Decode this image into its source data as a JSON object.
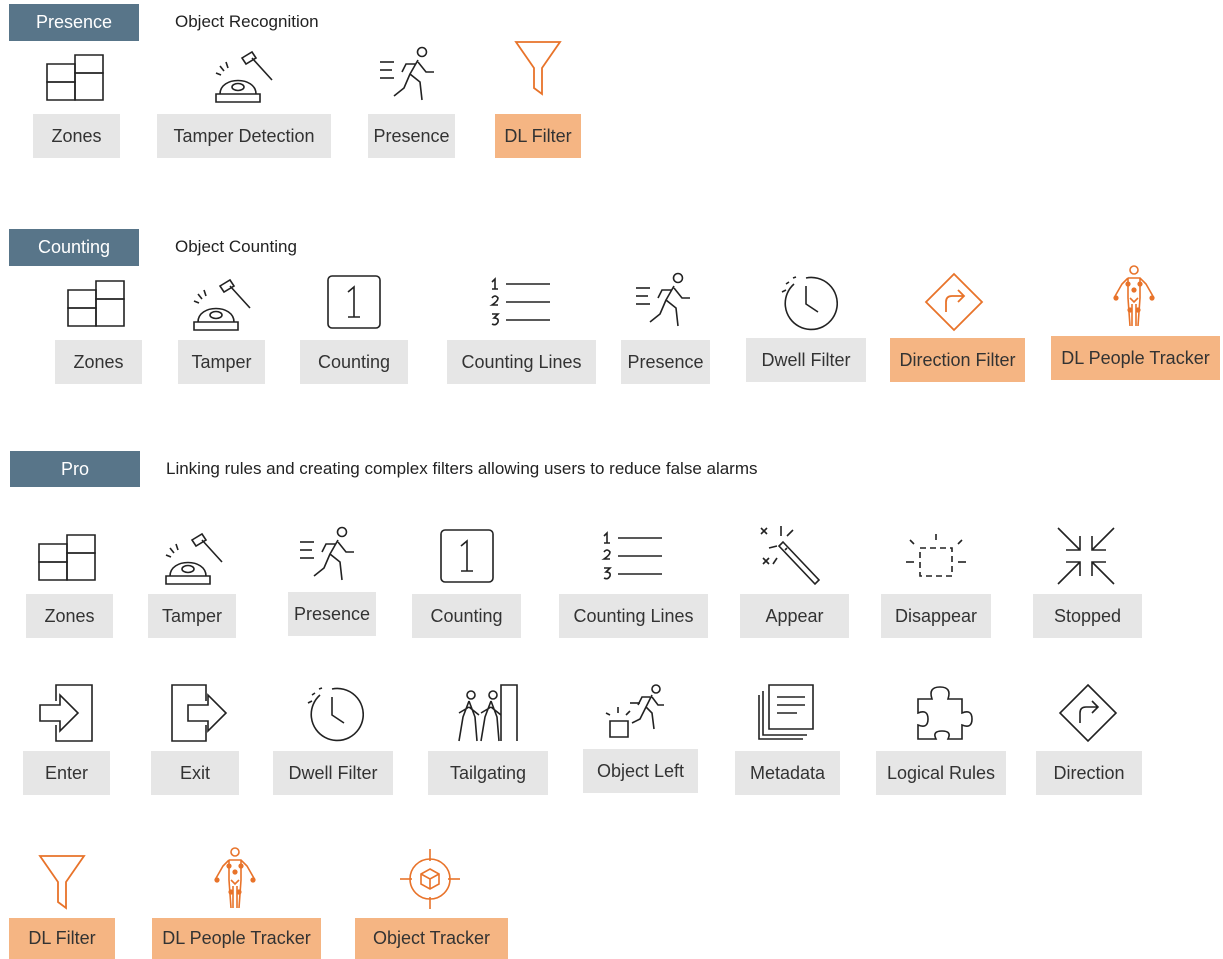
{
  "colors": {
    "tag_bg": "#587589",
    "tag_text": "#ffffff",
    "tile_bg": "#e6e6e6",
    "dl_bg": "#f5b583",
    "dl_icon": "#e8732a",
    "icon_stroke": "#222222"
  },
  "sections": [
    {
      "tag": "Presence",
      "description": "Object Recognition",
      "items": [
        {
          "icon": "zones-icon",
          "label": "Zones"
        },
        {
          "icon": "tamper-icon",
          "label": "Tamper Detection"
        },
        {
          "icon": "presence-icon",
          "label": "Presence"
        },
        {
          "icon": "filter-icon",
          "label": "DL Filter",
          "dl": true
        }
      ]
    },
    {
      "tag": "Counting",
      "description": "Object Counting",
      "items": [
        {
          "icon": "zones-icon",
          "label": "Zones"
        },
        {
          "icon": "tamper-icon",
          "label": "Tamper"
        },
        {
          "icon": "counting-icon",
          "label": "Counting"
        },
        {
          "icon": "counting-lines-icon",
          "label": "Counting Lines"
        },
        {
          "icon": "presence-icon",
          "label": "Presence"
        },
        {
          "icon": "dwell-icon",
          "label": "Dwell Filter"
        },
        {
          "icon": "direction-icon",
          "label": "Direction Filter",
          "dl": true
        },
        {
          "icon": "people-tracker-icon",
          "label": "DL People Tracker",
          "dl": true
        }
      ]
    },
    {
      "tag": "Pro",
      "description": "Linking rules and creating complex filters allowing users to reduce false alarms",
      "items": [
        {
          "icon": "zones-icon",
          "label": "Zones"
        },
        {
          "icon": "tamper-icon",
          "label": "Tamper"
        },
        {
          "icon": "presence-icon",
          "label": "Presence"
        },
        {
          "icon": "counting-icon",
          "label": "Counting"
        },
        {
          "icon": "counting-lines-icon",
          "label": "Counting Lines"
        },
        {
          "icon": "appear-icon",
          "label": "Appear"
        },
        {
          "icon": "disappear-icon",
          "label": "Disappear"
        },
        {
          "icon": "stopped-icon",
          "label": "Stopped"
        },
        {
          "icon": "enter-icon",
          "label": "Enter"
        },
        {
          "icon": "exit-icon",
          "label": "Exit"
        },
        {
          "icon": "dwell-icon",
          "label": "Dwell Filter"
        },
        {
          "icon": "tailgating-icon",
          "label": "Tailgating"
        },
        {
          "icon": "object-left-icon",
          "label": "Object Left"
        },
        {
          "icon": "metadata-icon",
          "label": "Metadata"
        },
        {
          "icon": "logical-rules-icon",
          "label": "Logical Rules"
        },
        {
          "icon": "direction-icon",
          "label": "Direction"
        },
        {
          "icon": "filter-icon",
          "label": "DL Filter",
          "dl": true
        },
        {
          "icon": "people-tracker-icon",
          "label": "DL People Tracker",
          "dl": true
        },
        {
          "icon": "object-tracker-icon",
          "label": "Object Tracker",
          "dl": true
        }
      ]
    }
  ]
}
